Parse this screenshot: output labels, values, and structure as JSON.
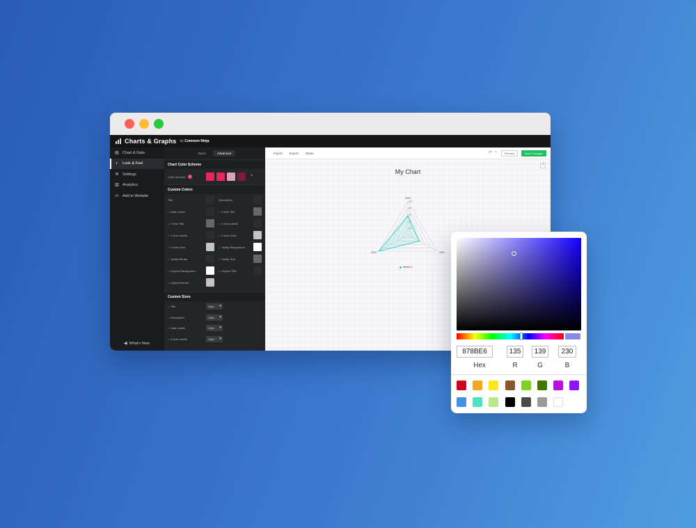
{
  "app": {
    "title": "Charts & Graphs",
    "by_prefix": "by",
    "by_brand": "Common Ninja"
  },
  "sidebar": {
    "items": [
      {
        "label": "Chart & Data",
        "icon": "table-icon"
      },
      {
        "label": "Look & Feel",
        "icon": "palette-icon",
        "active": true
      },
      {
        "label": "Settings",
        "icon": "gear-icon"
      },
      {
        "label": "Analytics",
        "icon": "bar-chart-icon"
      },
      {
        "label": "Add to Website",
        "icon": "code-icon"
      }
    ],
    "whats_new": "What's New"
  },
  "panel": {
    "tabs": [
      {
        "label": "Basic"
      },
      {
        "label": "Advanced",
        "active": true
      }
    ],
    "color_scheme_title": "Chart Color Scheme",
    "color_scheme_label": "Color Scheme",
    "color_scheme_badge": "1",
    "scheme_colors": [
      "#e8265e",
      "#e8265e",
      "#d9a0ba",
      "#7a1a3c"
    ],
    "custom_colors_title": "Custom Colors",
    "custom_colors": [
      {
        "label": "Title",
        "color": "#2c2d30"
      },
      {
        "label": "Description",
        "color": "#2c2d30"
      },
      {
        "label": "Data Labels",
        "color": "#2c2d30"
      },
      {
        "label": "X Axis Title",
        "color": "#666769"
      },
      {
        "label": "Y Axis Title",
        "color": "#666769"
      },
      {
        "label": "X Axis Labels",
        "color": "#2c2d30"
      },
      {
        "label": "Y Axis Labels",
        "color": "#2c2d30"
      },
      {
        "label": "X Axis Lines",
        "color": "#c4c4c4"
      },
      {
        "label": "Y Axis Lines",
        "color": "#c4c4c4"
      },
      {
        "label": "Tooltip Background",
        "color": "#ffffff"
      },
      {
        "label": "Tooltip Border",
        "color": "#2c2d30"
      },
      {
        "label": "Tooltip Text",
        "color": "#666769"
      },
      {
        "label": "Legend Background",
        "color": "#ffffff"
      },
      {
        "label": "Legend Title",
        "color": "#2c2d30"
      },
      {
        "label": "Legend Border",
        "color": "#c4c4c4"
      }
    ],
    "custom_sizes_title": "Custom Sizes",
    "custom_sizes": [
      {
        "label": "Title",
        "value": "24px"
      },
      {
        "label": "Description",
        "value": "14px"
      },
      {
        "label": "Data Labels",
        "value": "12px"
      },
      {
        "label": "X Axis Labels",
        "value": "12px"
      }
    ]
  },
  "preview": {
    "toolbar": {
      "import": "Import",
      "export": "Export",
      "share": "Share",
      "preview": "Preview",
      "save": "Save Changes",
      "help": "?"
    },
    "accent": "#1dbf61"
  },
  "chart_data": {
    "type": "radar",
    "title": "My Chart",
    "categories": [
      "2020",
      "2021",
      "2022"
    ],
    "tick_labels": [
      "20",
      "40",
      "60",
      "80",
      "100"
    ],
    "rlim": [
      0,
      100
    ],
    "series": [
      {
        "name": "Series 3",
        "values": [
          55,
          40,
          100
        ],
        "color": "#1fd0c3"
      }
    ]
  },
  "color_picker": {
    "hex": "878BE6",
    "r": "135",
    "g": "139",
    "b": "230",
    "labels": {
      "hex": "Hex",
      "r": "R",
      "g": "G",
      "b": "B"
    },
    "current_color": "#878BE6",
    "presets": [
      "#d0021b",
      "#f5a623",
      "#f8e71c",
      "#8b572a",
      "#7ed321",
      "#417505",
      "#bd10e0",
      "#9013fe",
      "#4a90e2",
      "#50e3c2",
      "#b8e986",
      "#000000",
      "#4a4a4a",
      "#9b9b9b",
      "#ffffff"
    ]
  }
}
